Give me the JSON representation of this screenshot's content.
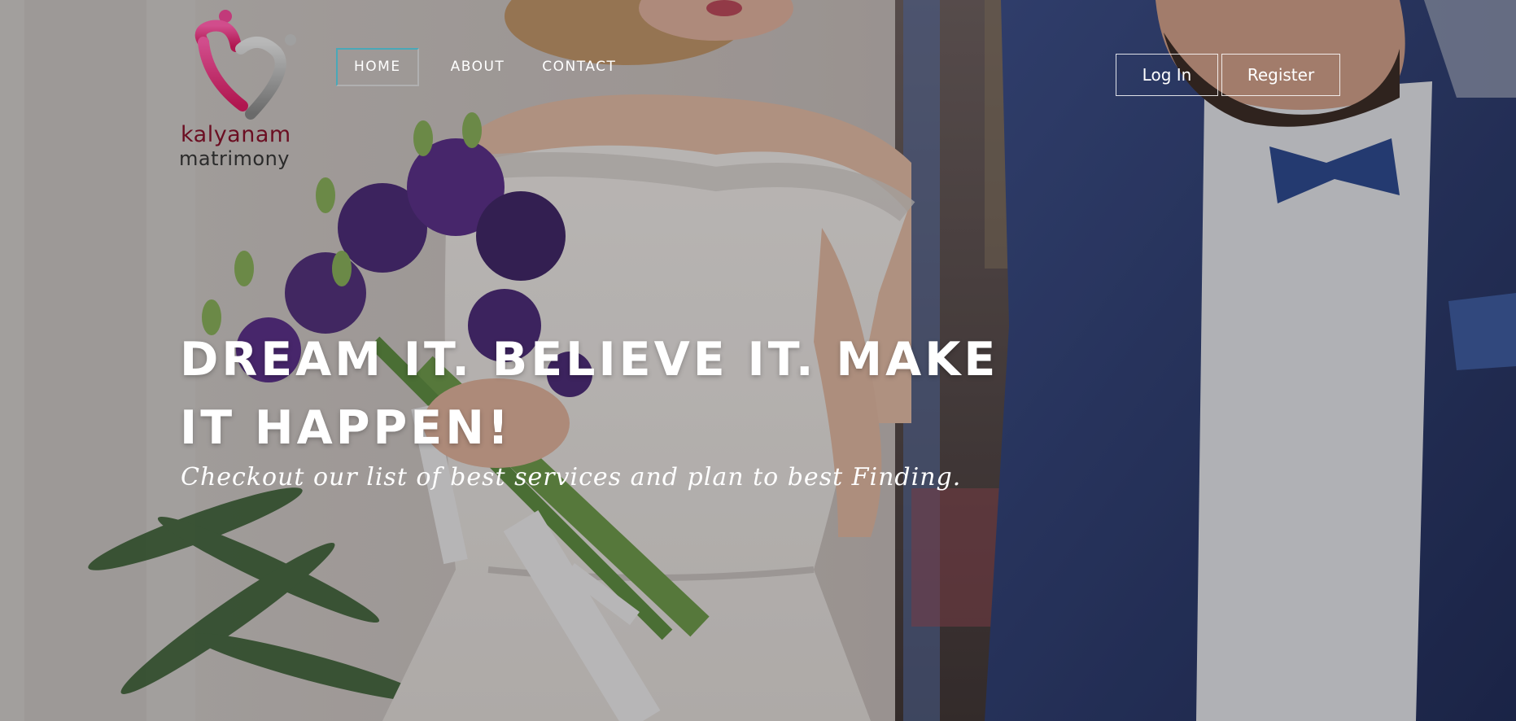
{
  "brand": {
    "name_line1": "kalyanam",
    "name_line2": "matrimony",
    "colors": {
      "pink": "#c2185b",
      "grey": "#8a8a8a",
      "maroon": "#6b0e22"
    }
  },
  "nav": {
    "items": [
      {
        "label": "HOME",
        "active": true
      },
      {
        "label": "ABOUT",
        "active": false
      },
      {
        "label": "CONTACT",
        "active": false
      }
    ]
  },
  "auth": {
    "login_label": "Log In",
    "register_label": "Register"
  },
  "hero": {
    "headline": "DREAM IT. BELIEVE IT. MAKE IT HAPPEN!",
    "tagline": "Checkout our list of best services and plan to best Finding.",
    "background": "wedding-couple-photo"
  }
}
